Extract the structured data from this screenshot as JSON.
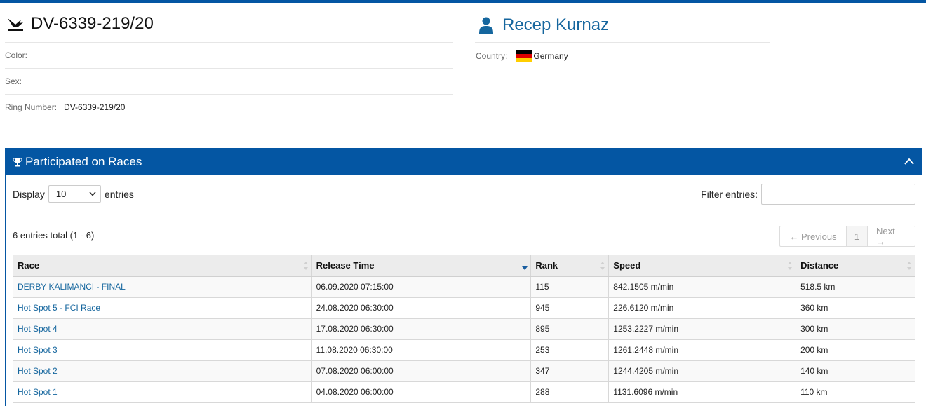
{
  "pigeon": {
    "title": "DV-6339-219/20",
    "fields": [
      {
        "label": "Color:",
        "value": ""
      },
      {
        "label": "Sex:",
        "value": ""
      },
      {
        "label": "Ring Number:",
        "value": "DV-6339-219/20"
      }
    ]
  },
  "owner": {
    "name": "Recep Kurnaz",
    "country_label": "Country:",
    "country": "Germany"
  },
  "panel": {
    "title": "Participated on Races",
    "length": {
      "prefix": "Display",
      "value": "10",
      "suffix": "entries"
    },
    "filter_label": "Filter entries:",
    "total": "6 entries total (1 - 6)",
    "pager": {
      "previous": "← Previous",
      "page": "1",
      "next": "Next →"
    },
    "columns": [
      "Race",
      "Release Time",
      "Rank",
      "Speed",
      "Distance"
    ],
    "rows": [
      {
        "race": "DERBY KALIMANCI - FINAL",
        "release": "06.09.2020 07:15:00",
        "rank": "115",
        "speed": "842.1505 m/min",
        "distance": "518.5 km"
      },
      {
        "race": "Hot Spot 5 - FCI Race",
        "release": "24.08.2020 06:30:00",
        "rank": "945",
        "speed": "226.6120 m/min",
        "distance": "360 km"
      },
      {
        "race": "Hot Spot 4",
        "release": "17.08.2020 06:30:00",
        "rank": "895",
        "speed": "1253.2227 m/min",
        "distance": "300 km"
      },
      {
        "race": "Hot Spot 3",
        "release": "11.08.2020 06:30:00",
        "rank": "253",
        "speed": "1261.2448 m/min",
        "distance": "200 km"
      },
      {
        "race": "Hot Spot 2",
        "release": "07.08.2020 06:00:00",
        "rank": "347",
        "speed": "1244.4205 m/min",
        "distance": "140 km"
      },
      {
        "race": "Hot Spot 1",
        "release": "04.08.2020 06:00:00",
        "rank": "288",
        "speed": "1131.6096 m/min",
        "distance": "110 km"
      }
    ]
  },
  "colors": {
    "brand": "#0456a3",
    "link": "#15669e"
  },
  "icons": {
    "pigeon": "pigeon-icon",
    "user": "user-icon",
    "trophy": "trophy-icon",
    "collapse": "chevron-up-icon"
  }
}
